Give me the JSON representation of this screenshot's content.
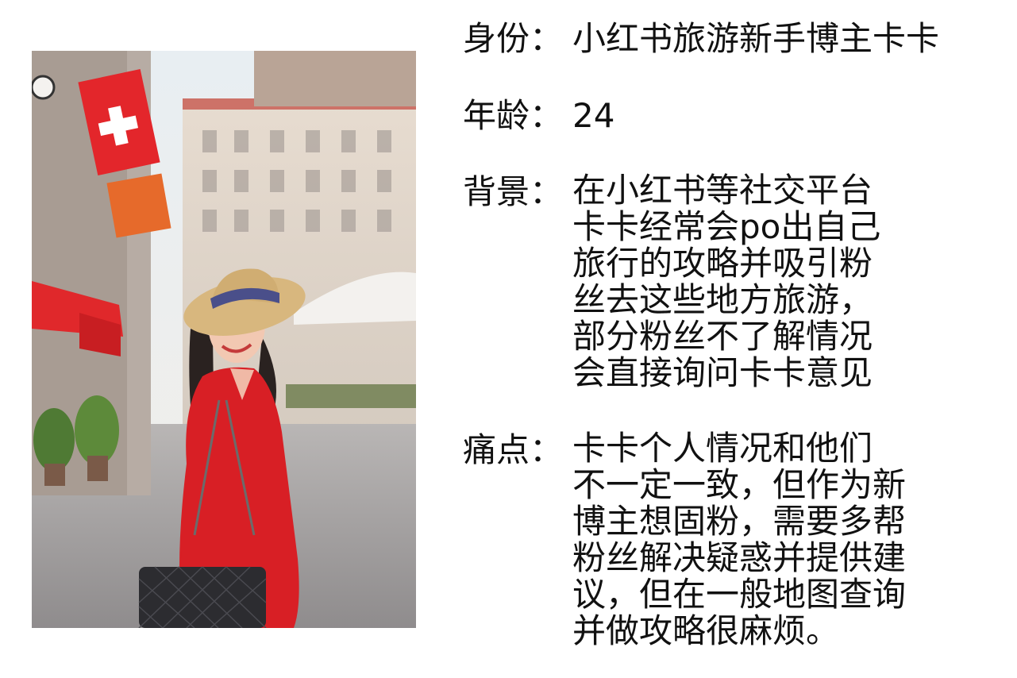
{
  "persona": {
    "identity": {
      "label": "身份：",
      "value": "小红书旅游新手博主卡卡"
    },
    "age": {
      "label": "年龄：",
      "value": "24"
    },
    "background": {
      "label": "背景：",
      "lines": [
        "在小红书等社交平台",
        "卡卡经常会po出自己",
        "旅行的攻略并吸引粉",
        "丝去这些地方旅游，",
        "部分粉丝不了解情况",
        "会直接询问卡卡意见"
      ]
    },
    "pain_points": {
      "label": "痛点：",
      "lines": [
        "卡卡个人情况和他们",
        "不一定一致，但作为新",
        "博主想固粉，需要多帮",
        "粉丝解决疑惑并提供建",
        "议，但在一般地图查询",
        "并做攻略很麻烦。"
      ]
    }
  },
  "colors": {
    "coat": "#d81f25",
    "hat": "#d8b77e",
    "flag": "#e3262b",
    "awning": "#e0282b"
  }
}
